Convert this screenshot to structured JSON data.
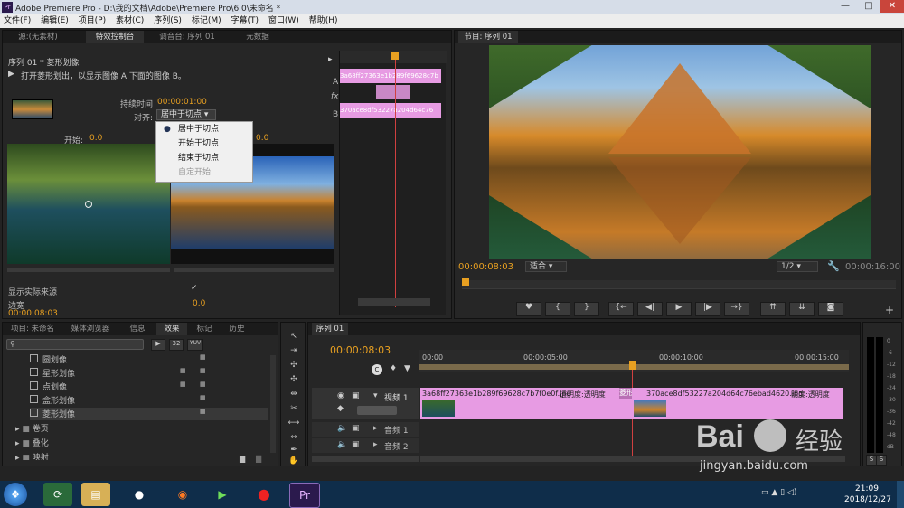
{
  "window": {
    "title": "Adobe Premiere Pro - D:\\我的文档\\Adobe\\Premiere Pro\\6.0\\未命名 *",
    "app_icon": "Pr",
    "minimize": "—",
    "maximize": "□",
    "close": "✕"
  },
  "menu": [
    "文件(F)",
    "编辑(E)",
    "项目(P)",
    "素材(C)",
    "序列(S)",
    "标记(M)",
    "字幕(T)",
    "窗口(W)",
    "帮助(H)"
  ],
  "source_panel": {
    "tabs": [
      "源:(无素材)",
      "特效控制台",
      "调音台: 序列 01",
      "元数据"
    ],
    "header": "序列 01 * 菱形划像",
    "description": "打开菱形划出，以显示图像 A 下面的图像 B。",
    "duration_label": "持续时间",
    "duration_value": "00:00:01:00",
    "align_label": "对齐:",
    "align_value": "居中于切点",
    "start_label": "开始:",
    "start_value": "0.0",
    "end_value": "0.0",
    "show_source_label": "显示实际来源",
    "border_label": "边宽",
    "border_value": "0.0",
    "timecode": "00:00:08:03",
    "mini_clip_a": "3a68ff27363e1b289f69628c7b",
    "mini_clip_b": "370ace8df53227a204d64c76",
    "label_a": "A",
    "label_b": "B",
    "label_fx": "fx"
  },
  "align_dropdown": {
    "options": [
      "居中于切点",
      "开始于切点",
      "结束于切点",
      "自定开始"
    ],
    "selected": "居中于切点"
  },
  "program_panel": {
    "tab": "节目: 序列 01",
    "timecode": "00:00:08:03",
    "fit": "适合",
    "quality": "1/2",
    "duration": "00:00:16:00"
  },
  "project_panel": {
    "tabs": [
      "项目: 未命名",
      "媒体浏览器",
      "信息",
      "效果",
      "标记",
      "历史"
    ],
    "badges": [
      "32",
      "YUV"
    ],
    "items": [
      "圆划像",
      "星形划像",
      "点划像",
      "盒形划像",
      "菱形划像"
    ],
    "folders": [
      "卷页",
      "叠化",
      "映射"
    ]
  },
  "timeline": {
    "tab": "序列 01",
    "timecode": "00:00:08:03",
    "ruler": [
      "00:00",
      "00:00:05:00",
      "00:00:10:00",
      "00:00:15:00"
    ],
    "video_track": "视频 1",
    "audio_tracks": [
      "音频 1",
      "音频 2"
    ],
    "clip1": "3a68ff27363e1b289f69628c7b7f0e0f.jpg",
    "clip1_opacity": "透明度:透明度",
    "transition": "菱形划",
    "clip2": "370ace8df53227a204d64c76ebad4620.jpg",
    "clip2_opacity": "明度:透明度"
  },
  "meter": {
    "labels": [
      "0",
      "-6",
      "-12",
      "-18",
      "-24",
      "-30",
      "-36",
      "-42",
      "-48",
      "dB"
    ],
    "s": "S"
  },
  "taskbar": {
    "time": "21:09",
    "date": "2018/12/27"
  },
  "watermark": {
    "brand": "Bai",
    "brand2": "经验",
    "url": "jingyan.baidu.com"
  },
  "colors": {
    "accent": "#e8a021",
    "clip": "#e79be3",
    "playhead": "#d04040"
  }
}
